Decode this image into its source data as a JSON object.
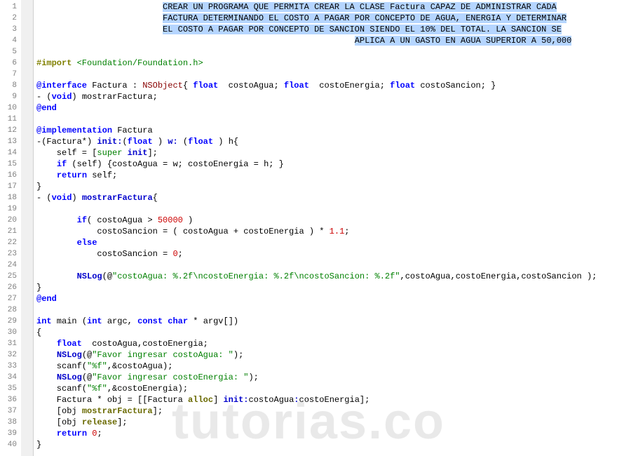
{
  "watermark": "tutorias.co",
  "lines": [
    {
      "n": 1,
      "segs": [
        {
          "t": "                         ",
          "c": "txt"
        },
        {
          "t": "CREAR UN PROGRAMA QUE PERMITA CREAR LA CLASE Factura CAPAZ DE ADMINISTRAR CADA",
          "c": "hl-select"
        }
      ]
    },
    {
      "n": 2,
      "segs": [
        {
          "t": "                         ",
          "c": "txt"
        },
        {
          "t": "FACTURA DETERMINANDO EL COSTO A PAGAR POR CONCEPTO DE AGUA, ENERGIA Y DETERMINAR",
          "c": "hl-select"
        }
      ]
    },
    {
      "n": 3,
      "segs": [
        {
          "t": "                         ",
          "c": "txt"
        },
        {
          "t": "EL COSTO A PAGAR POR CONCEPTO DE SANCION SIENDO EL 10% DEL TOTAL. LA SANCION SE",
          "c": "hl-select"
        }
      ]
    },
    {
      "n": 4,
      "segs": [
        {
          "t": "                                                               ",
          "c": "txt"
        },
        {
          "t": "APLICA A UN GASTO EN AGUA SUPERIOR A 50,000",
          "c": "hl-select"
        }
      ]
    },
    {
      "n": 5,
      "segs": []
    },
    {
      "n": 6,
      "segs": [
        {
          "t": "#import ",
          "c": "prep"
        },
        {
          "t": "<Foundation/Foundation.h>",
          "c": "inc"
        }
      ]
    },
    {
      "n": 7,
      "segs": []
    },
    {
      "n": 8,
      "segs": [
        {
          "t": "@interface",
          "c": "kw"
        },
        {
          "t": " Factura : ",
          "c": "txt"
        },
        {
          "t": "NSObject",
          "c": "cls"
        },
        {
          "t": "{ ",
          "c": "txt"
        },
        {
          "t": "float",
          "c": "kw"
        },
        {
          "t": "  costoAgua; ",
          "c": "txt"
        },
        {
          "t": "float",
          "c": "kw"
        },
        {
          "t": "  costoEnergia; ",
          "c": "txt"
        },
        {
          "t": "float",
          "c": "kw"
        },
        {
          "t": " costoSancion; }",
          "c": "txt"
        }
      ]
    },
    {
      "n": 9,
      "segs": [
        {
          "t": "- (",
          "c": "txt"
        },
        {
          "t": "void",
          "c": "kw"
        },
        {
          "t": ") mostrarFactura;",
          "c": "txt"
        }
      ]
    },
    {
      "n": 10,
      "segs": [
        {
          "t": "@end",
          "c": "kw"
        }
      ]
    },
    {
      "n": 11,
      "segs": []
    },
    {
      "n": 12,
      "segs": [
        {
          "t": "@implementation",
          "c": "kw"
        },
        {
          "t": " Factura",
          "c": "txt"
        }
      ]
    },
    {
      "n": 13,
      "segs": [
        {
          "t": "-(Factura*) ",
          "c": "txt"
        },
        {
          "t": "init:",
          "c": "typ"
        },
        {
          "t": "(",
          "c": "txt"
        },
        {
          "t": "float",
          "c": "kw"
        },
        {
          "t": " ) ",
          "c": "txt"
        },
        {
          "t": "w:",
          "c": "typ"
        },
        {
          "t": " (",
          "c": "txt"
        },
        {
          "t": "float",
          "c": "kw"
        },
        {
          "t": " ) ",
          "c": "txt"
        },
        {
          "t": "h",
          "c": "txt"
        },
        {
          "t": "{",
          "c": "txt"
        }
      ]
    },
    {
      "n": 14,
      "segs": [
        {
          "t": "    self = [",
          "c": "txt"
        },
        {
          "t": "super",
          "c": "inc"
        },
        {
          "t": " ",
          "c": "txt"
        },
        {
          "t": "init",
          "c": "typ"
        },
        {
          "t": "];",
          "c": "txt"
        }
      ]
    },
    {
      "n": 15,
      "segs": [
        {
          "t": "    ",
          "c": "txt"
        },
        {
          "t": "if",
          "c": "kw"
        },
        {
          "t": " (self) {costoAgua = w; costoEnergia = h; }",
          "c": "txt"
        }
      ]
    },
    {
      "n": 16,
      "segs": [
        {
          "t": "    ",
          "c": "txt"
        },
        {
          "t": "return",
          "c": "kw"
        },
        {
          "t": " self;",
          "c": "txt"
        }
      ]
    },
    {
      "n": 17,
      "segs": [
        {
          "t": "}",
          "c": "txt"
        }
      ]
    },
    {
      "n": 18,
      "segs": [
        {
          "t": "- (",
          "c": "txt"
        },
        {
          "t": "void",
          "c": "kw"
        },
        {
          "t": ") ",
          "c": "txt"
        },
        {
          "t": "mostrarFactura",
          "c": "typ"
        },
        {
          "t": "{",
          "c": "txt"
        }
      ]
    },
    {
      "n": 19,
      "segs": []
    },
    {
      "n": 20,
      "segs": [
        {
          "t": "        ",
          "c": "txt"
        },
        {
          "t": "if",
          "c": "kw"
        },
        {
          "t": "( costoAgua > ",
          "c": "txt"
        },
        {
          "t": "50000",
          "c": "num"
        },
        {
          "t": " )",
          "c": "txt"
        }
      ]
    },
    {
      "n": 21,
      "segs": [
        {
          "t": "            costoSancion = ( costoAgua + costoEnergia ) * ",
          "c": "txt"
        },
        {
          "t": "1.1",
          "c": "num"
        },
        {
          "t": ";",
          "c": "txt"
        }
      ]
    },
    {
      "n": 22,
      "segs": [
        {
          "t": "        ",
          "c": "txt"
        },
        {
          "t": "else",
          "c": "kw"
        }
      ]
    },
    {
      "n": 23,
      "segs": [
        {
          "t": "            costoSancion = ",
          "c": "txt"
        },
        {
          "t": "0",
          "c": "num"
        },
        {
          "t": ";",
          "c": "txt"
        }
      ]
    },
    {
      "n": 24,
      "segs": []
    },
    {
      "n": 25,
      "segs": [
        {
          "t": "        ",
          "c": "txt"
        },
        {
          "t": "NSLog",
          "c": "typ"
        },
        {
          "t": "(@",
          "c": "txt"
        },
        {
          "t": "\"costoAgua: %.2f\\ncostoEnergia: %.2f\\ncostoSancion: %.2f\"",
          "c": "inc"
        },
        {
          "t": ",costoAgua,costoEnergia,costoSancion );",
          "c": "txt"
        }
      ]
    },
    {
      "n": 26,
      "segs": [
        {
          "t": "}",
          "c": "txt"
        }
      ]
    },
    {
      "n": 27,
      "segs": [
        {
          "t": "@end",
          "c": "kw"
        }
      ]
    },
    {
      "n": 28,
      "segs": []
    },
    {
      "n": 29,
      "segs": [
        {
          "t": "int",
          "c": "kw"
        },
        {
          "t": " main (",
          "c": "txt"
        },
        {
          "t": "int",
          "c": "kw"
        },
        {
          "t": " argc, ",
          "c": "txt"
        },
        {
          "t": "const",
          "c": "kw"
        },
        {
          "t": " ",
          "c": "txt"
        },
        {
          "t": "char",
          "c": "kw"
        },
        {
          "t": " * argv[])",
          "c": "txt"
        }
      ]
    },
    {
      "n": 30,
      "segs": [
        {
          "t": "{",
          "c": "txt"
        }
      ]
    },
    {
      "n": 31,
      "segs": [
        {
          "t": "    ",
          "c": "txt"
        },
        {
          "t": "float",
          "c": "kw"
        },
        {
          "t": "  costoAgua,costoEnergia;",
          "c": "txt"
        }
      ]
    },
    {
      "n": 32,
      "segs": [
        {
          "t": "    ",
          "c": "txt"
        },
        {
          "t": "NSLog",
          "c": "typ"
        },
        {
          "t": "(@",
          "c": "txt"
        },
        {
          "t": "\"Favor ingresar costoAgua: \"",
          "c": "inc"
        },
        {
          "t": ");",
          "c": "txt"
        }
      ]
    },
    {
      "n": 33,
      "segs": [
        {
          "t": "    scanf(",
          "c": "txt"
        },
        {
          "t": "\"%f\"",
          "c": "inc"
        },
        {
          "t": ",&costoAgua);",
          "c": "txt"
        }
      ]
    },
    {
      "n": 34,
      "segs": [
        {
          "t": "    ",
          "c": "txt"
        },
        {
          "t": "NSLog",
          "c": "typ"
        },
        {
          "t": "(@",
          "c": "txt"
        },
        {
          "t": "\"Favor ingresar costoEnergia: \"",
          "c": "inc"
        },
        {
          "t": ");",
          "c": "txt"
        }
      ]
    },
    {
      "n": 35,
      "segs": [
        {
          "t": "    scanf(",
          "c": "txt"
        },
        {
          "t": "\"%f\"",
          "c": "inc"
        },
        {
          "t": ",&costoEnergia);",
          "c": "txt"
        }
      ]
    },
    {
      "n": 36,
      "segs": [
        {
          "t": "    Factura * obj = [[Factura ",
          "c": "txt"
        },
        {
          "t": "alloc",
          "c": "mth"
        },
        {
          "t": "] ",
          "c": "txt"
        },
        {
          "t": "init:",
          "c": "typ"
        },
        {
          "t": "costoAgua",
          "c": "txt"
        },
        {
          "t": ":",
          "c": "typ"
        },
        {
          "t": "costoEnergia];",
          "c": "txt"
        }
      ]
    },
    {
      "n": 37,
      "segs": [
        {
          "t": "    [obj ",
          "c": "txt"
        },
        {
          "t": "mostrarFactura",
          "c": "mth"
        },
        {
          "t": "];",
          "c": "txt"
        }
      ]
    },
    {
      "n": 38,
      "segs": [
        {
          "t": "    [obj ",
          "c": "txt"
        },
        {
          "t": "release",
          "c": "mth"
        },
        {
          "t": "];",
          "c": "txt"
        }
      ]
    },
    {
      "n": 39,
      "segs": [
        {
          "t": "    ",
          "c": "txt"
        },
        {
          "t": "return",
          "c": "kw"
        },
        {
          "t": " ",
          "c": "txt"
        },
        {
          "t": "0",
          "c": "num"
        },
        {
          "t": ";",
          "c": "txt"
        }
      ]
    },
    {
      "n": 40,
      "segs": [
        {
          "t": "}",
          "c": "txt"
        }
      ]
    }
  ]
}
